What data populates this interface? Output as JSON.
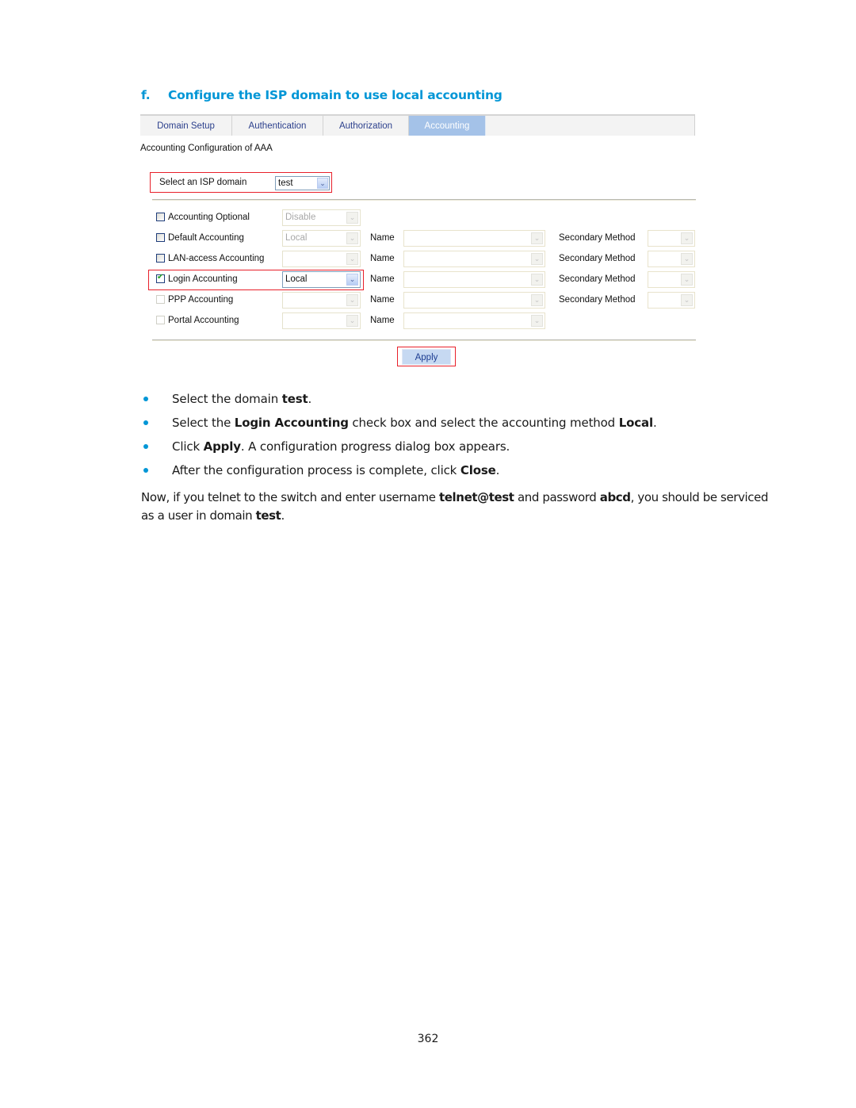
{
  "heading": {
    "number": "f.",
    "title": "Configure the ISP domain to use local accounting"
  },
  "ui": {
    "tabs": [
      {
        "label": "Domain Setup",
        "active": false
      },
      {
        "label": "Authentication",
        "active": false
      },
      {
        "label": "Authorization",
        "active": false
      },
      {
        "label": "Accounting",
        "active": true
      }
    ],
    "subtitle": "Accounting Configuration of AAA",
    "isp_domain": {
      "label": "Select an ISP domain",
      "value": "test"
    },
    "rows": [
      {
        "label": "Accounting Optional",
        "checked": false,
        "enabled": true,
        "method": "Disable",
        "name_label": "",
        "secondary_label": ""
      },
      {
        "label": "Default Accounting",
        "checked": false,
        "enabled": true,
        "method": "Local",
        "name_label": "Name",
        "secondary_label": "Secondary Method"
      },
      {
        "label": "LAN-access Accounting",
        "checked": false,
        "enabled": true,
        "method": "",
        "name_label": "Name",
        "secondary_label": "Secondary Method"
      },
      {
        "label": "Login Accounting",
        "checked": true,
        "enabled": true,
        "method": "Local",
        "name_label": "Name",
        "secondary_label": "Secondary Method"
      },
      {
        "label": "PPP Accounting",
        "checked": false,
        "enabled": false,
        "method": "",
        "name_label": "Name",
        "secondary_label": "Secondary Method"
      },
      {
        "label": "Portal Accounting",
        "checked": false,
        "enabled": false,
        "method": "",
        "name_label": "Name",
        "secondary_label": ""
      }
    ],
    "apply_label": "Apply",
    "dropdown_arrow_icon": "chevron-down"
  },
  "steps": [
    {
      "parts": [
        {
          "t": "Select the domain "
        },
        {
          "b": "test"
        },
        {
          "t": "."
        }
      ]
    },
    {
      "parts": [
        {
          "t": "Select the "
        },
        {
          "b": "Login Accounting"
        },
        {
          "t": " check box and select the accounting method "
        },
        {
          "b": "Local"
        },
        {
          "t": "."
        }
      ]
    },
    {
      "parts": [
        {
          "t": "Click "
        },
        {
          "b": "Apply"
        },
        {
          "t": ". A configuration progress dialog box appears."
        }
      ]
    },
    {
      "parts": [
        {
          "t": "After the configuration process is complete, click "
        },
        {
          "b": "Close"
        },
        {
          "t": "."
        }
      ]
    }
  ],
  "paragraph": {
    "parts": [
      {
        "t": "Now, if you telnet to the switch and enter username "
      },
      {
        "b": "telnet@test"
      },
      {
        "t": " and password "
      },
      {
        "b": "abcd"
      },
      {
        "t": ", you should be serviced as a user in domain "
      },
      {
        "b": "test"
      },
      {
        "t": "."
      }
    ]
  },
  "page_number": "362",
  "colors": {
    "heading": "#0096d6",
    "active_tab": "#a4c2e8",
    "highlight_box": "#e8202a",
    "apply_button": "#c6d9f2"
  }
}
